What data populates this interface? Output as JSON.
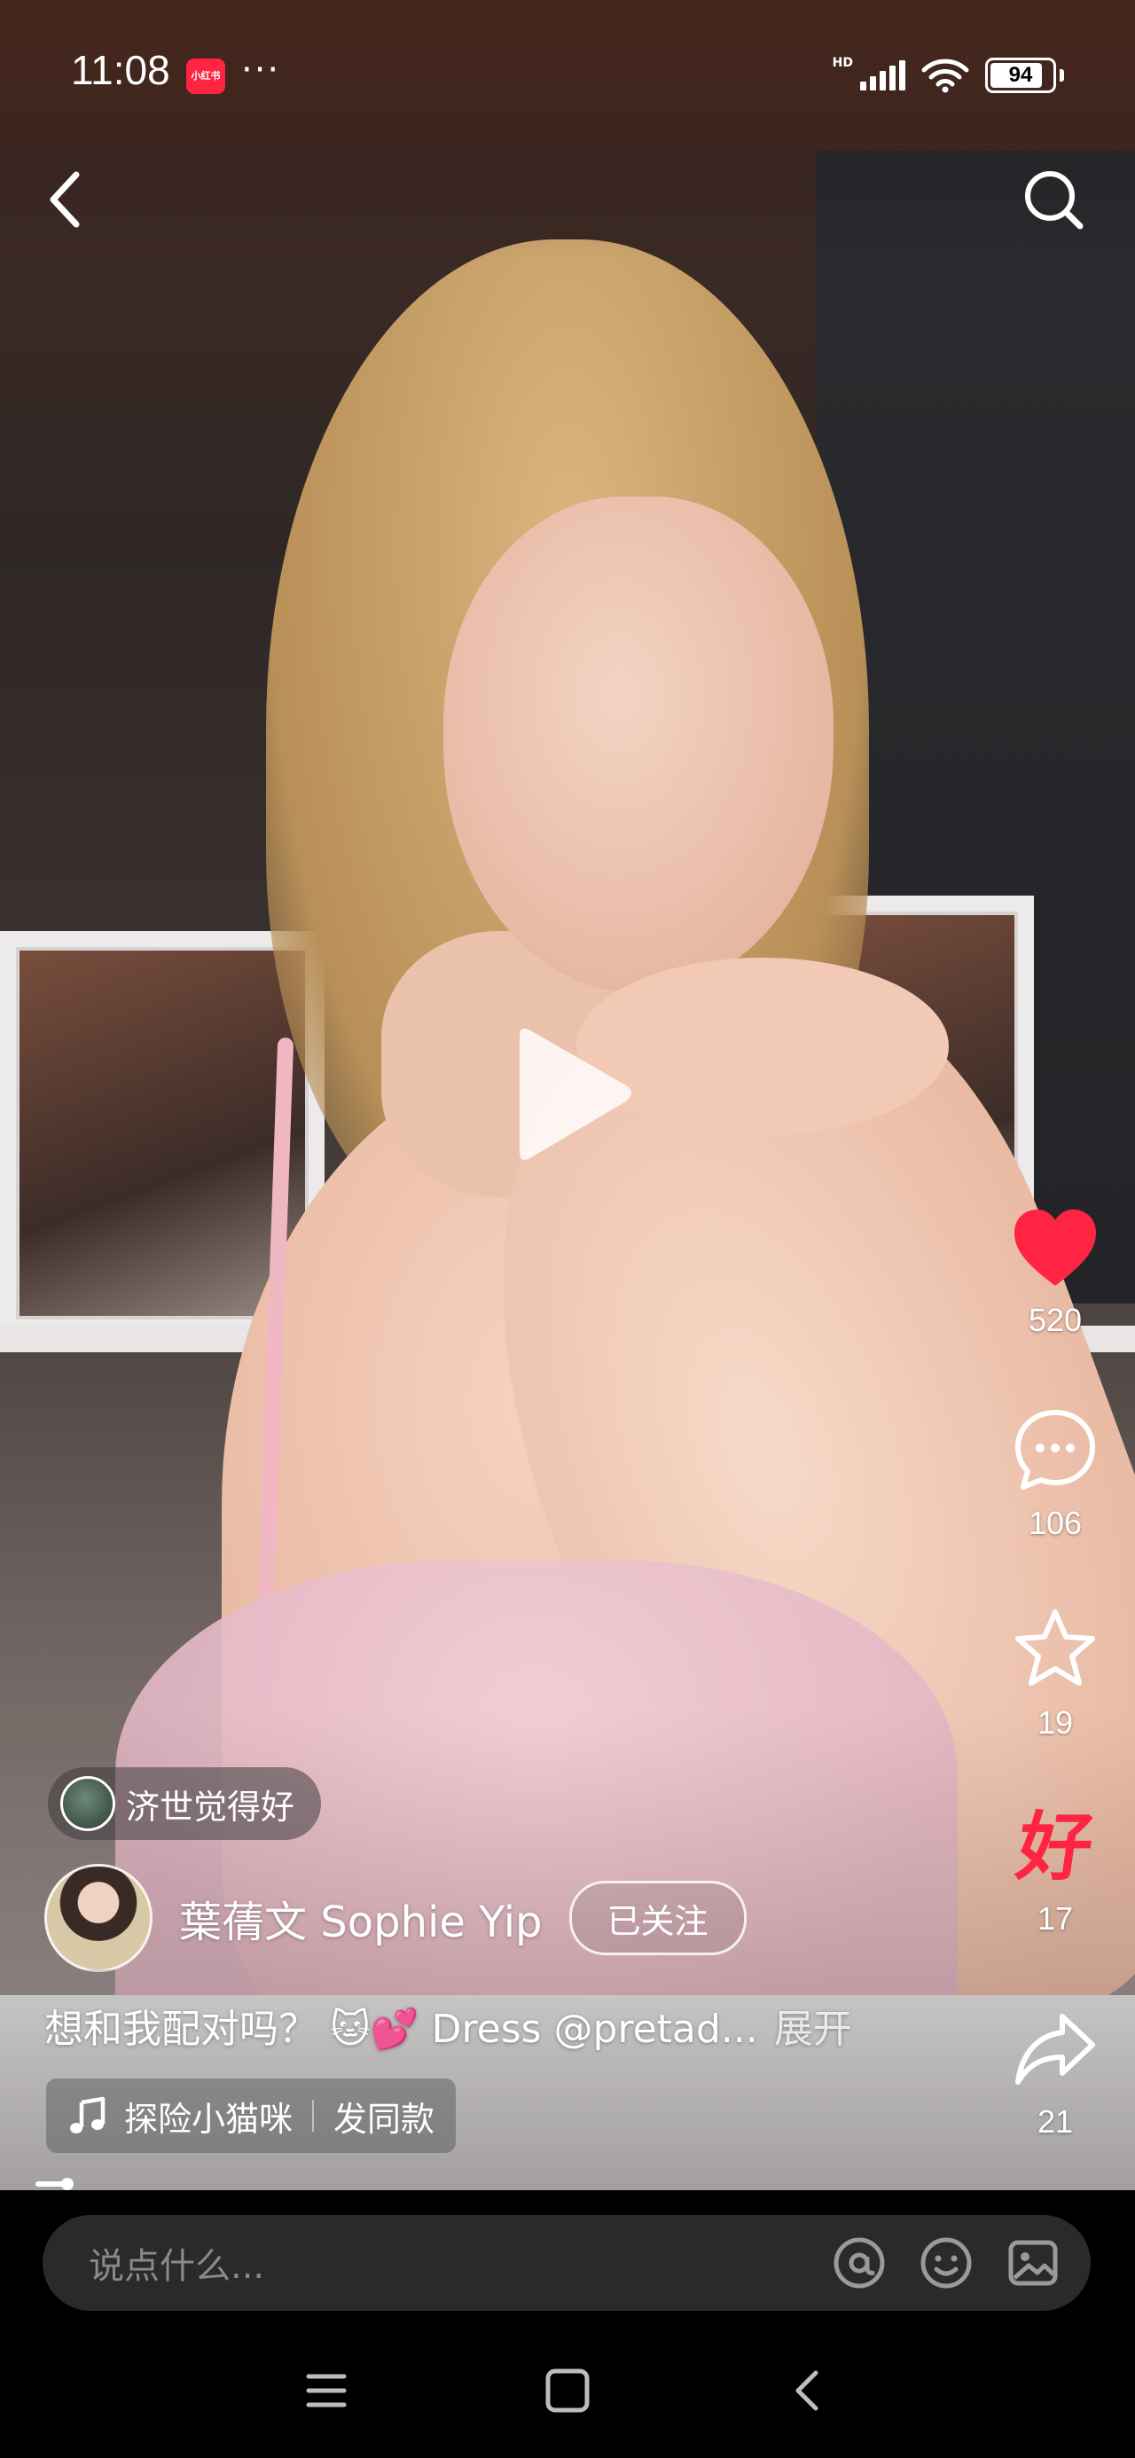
{
  "status_bar": {
    "time": "11:08",
    "app_badge": "小红书",
    "more": "···",
    "network": "HD",
    "battery": "94"
  },
  "video": {
    "playing": false
  },
  "topic": {
    "label": "济世觉得好"
  },
  "author": {
    "name": "葉蒨文 Sophie Yip",
    "follow_state": "已关注"
  },
  "caption": {
    "text": "想和我配对吗？ 🐱💕 Dress @pretad...",
    "expand": "展开"
  },
  "music": {
    "title": "探险小猫咪",
    "use_same": "发同款"
  },
  "actions": {
    "likes": "520",
    "comments": "106",
    "favorites": "19",
    "good": "17",
    "good_glyph": "好",
    "shares": "21"
  },
  "colors": {
    "accent": "#ff2442",
    "comment_bg": "#2a2a2a"
  },
  "playback": {
    "progress": 0.03
  },
  "comment_bar": {
    "placeholder": "说点什么..."
  },
  "icons": {
    "back": "chevron-left-icon",
    "search": "search-icon",
    "like": "heart-icon",
    "comment": "comment-bubble-icon",
    "favorite": "star-icon",
    "share": "share-arrow-icon",
    "mention": "at-icon",
    "emoji": "smile-icon",
    "image": "image-icon"
  }
}
